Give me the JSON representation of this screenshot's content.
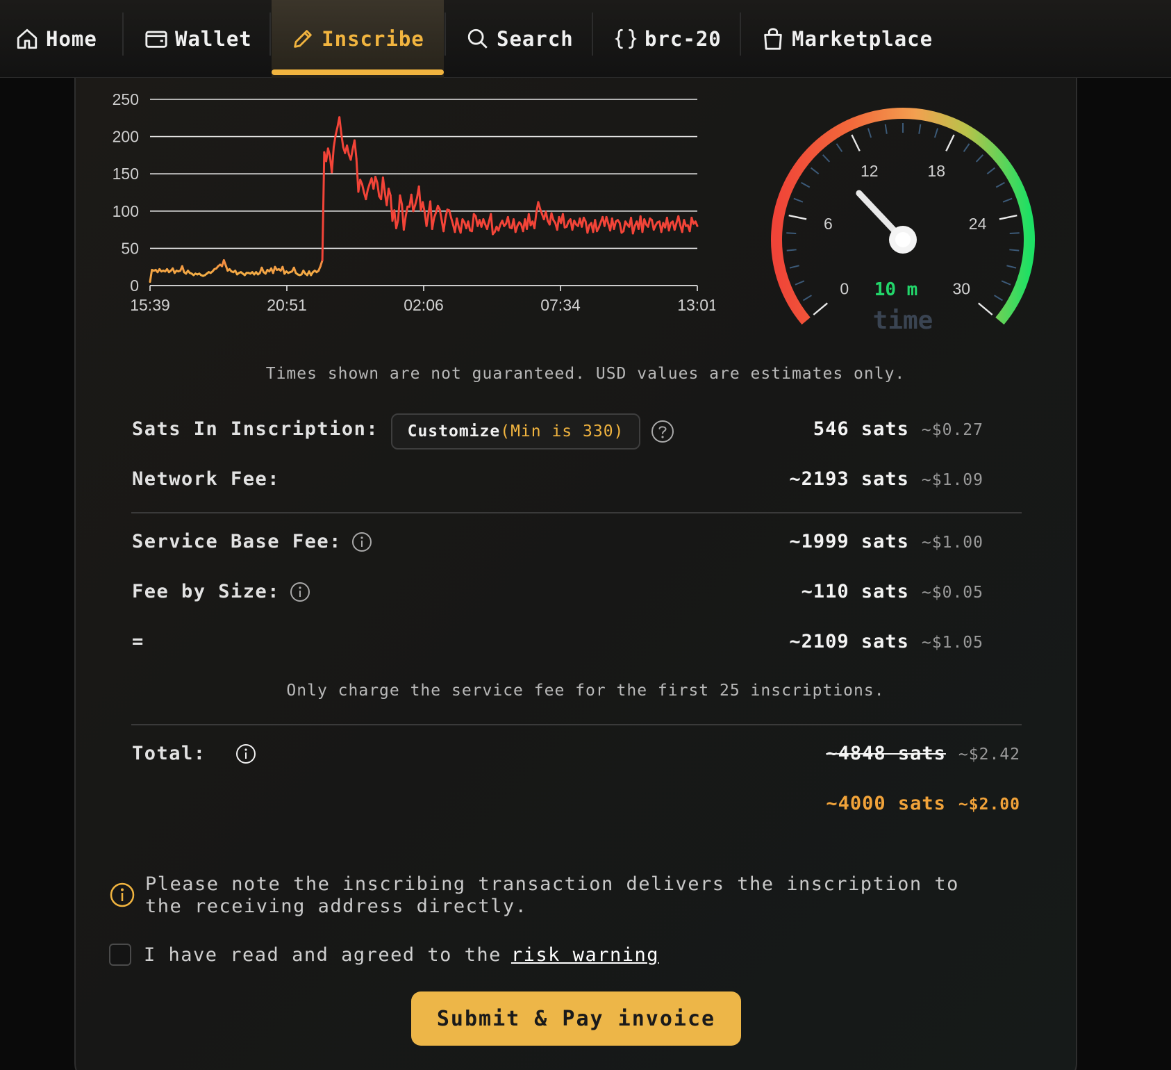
{
  "nav": {
    "items": [
      {
        "label": "Home",
        "icon": "home-icon"
      },
      {
        "label": "Wallet",
        "icon": "wallet-icon"
      },
      {
        "label": "Inscribe",
        "icon": "pencil-icon",
        "active": true
      },
      {
        "label": "Search",
        "icon": "search-icon"
      },
      {
        "label": "brc-20",
        "icon": "braces-icon"
      },
      {
        "label": "Marketplace",
        "icon": "shopping-bag-icon"
      }
    ]
  },
  "chart_data": {
    "type": "line",
    "x_ticks": [
      "15:39",
      "20:51",
      "02:06",
      "07:34",
      "13:01"
    ],
    "y_ticks": [
      "0",
      "50",
      "100",
      "150",
      "200",
      "250"
    ],
    "ylim": [
      0,
      250
    ],
    "grid": true,
    "series": [
      {
        "values": [
          5,
          21,
          20,
          21,
          18,
          22,
          19,
          20,
          19,
          22,
          18,
          20,
          23,
          17,
          20,
          19,
          20,
          26,
          18,
          16,
          20,
          17,
          16,
          14,
          16,
          15,
          16,
          14,
          13,
          14,
          16,
          18,
          17,
          19,
          22,
          23,
          26,
          28,
          26,
          34,
          27,
          20,
          22,
          19,
          18,
          20,
          15,
          17,
          18,
          16,
          14,
          17,
          17,
          16,
          18,
          15,
          18,
          15,
          17,
          24,
          18,
          16,
          21,
          19,
          23,
          17,
          25,
          21,
          22,
          20,
          25,
          16,
          19,
          17,
          18,
          19,
          24,
          17,
          15,
          14,
          15,
          20,
          16,
          14,
          19,
          14,
          18,
          20,
          18,
          20,
          26,
          34,
          179,
          167,
          184,
          174,
          152,
          186,
          202,
          213,
          226,
          204,
          186,
          178,
          188,
          176,
          169,
          183,
          195,
          170,
          126,
          142,
          136,
          125,
          116,
          129,
          137,
          144,
          130,
          146,
          138,
          120,
          116,
          145,
          125,
          108,
          130,
          121,
          87,
          101,
          77,
          88,
          121,
          109,
          75,
          93,
          106,
          106,
          122,
          100,
          108,
          118,
          133,
          101,
          112,
          99,
          80,
          96,
          113,
          76,
          91,
          98,
          107,
          102,
          88,
          73,
          91,
          102,
          101,
          91,
          82,
          72,
          90,
          79,
          71,
          89,
          85,
          77,
          86,
          74,
          73,
          96,
          93,
          80,
          88,
          79,
          89,
          82,
          76,
          86,
          96,
          69,
          72,
          79,
          74,
          82,
          87,
          80,
          83,
          92,
          78,
          77,
          89,
          72,
          80,
          85,
          82,
          73,
          89,
          76,
          96,
          81,
          86,
          77,
          98,
          112,
          103,
          96,
          89,
          99,
          87,
          82,
          97,
          88,
          84,
          75,
          92,
          84,
          96,
          78,
          79,
          86,
          89,
          75,
          87,
          82,
          80,
          90,
          79,
          91,
          86,
          71,
          81,
          84,
          72,
          88,
          73,
          78,
          85,
          92,
          80,
          92,
          83,
          74,
          90,
          76,
          86,
          88,
          84,
          71,
          73,
          86,
          82,
          79,
          91,
          70,
          80,
          86,
          76,
          93,
          72,
          89,
          82,
          79,
          90,
          88,
          75,
          81,
          85,
          86,
          72,
          84,
          78,
          91,
          74,
          84,
          86,
          75,
          84,
          93,
          81,
          72,
          88,
          80,
          81,
          73,
          91,
          83,
          86,
          80
        ]
      }
    ]
  },
  "gauge": {
    "ticks": [
      "0",
      "6",
      "12",
      "18",
      "24",
      "30"
    ],
    "value": 10,
    "max": 30,
    "value_label": "10 m",
    "caption": "time"
  },
  "disclaimer": "Times shown are not guaranteed. USD values are estimates only.",
  "fees": {
    "sats_in_inscription": {
      "label": "Sats In Inscription:",
      "customize": "Customize",
      "customize_min": "(Min is 330)",
      "value": "546 sats",
      "usd": "~$0.27"
    },
    "network_fee": {
      "label": "Network Fee:",
      "value": "~2193 sats",
      "usd": "~$1.09"
    },
    "service_base_fee": {
      "label": "Service Base Fee:",
      "value": "~1999 sats",
      "usd": "~$1.00"
    },
    "fee_by_size": {
      "label": "Fee by Size:",
      "value": "~110 sats",
      "usd": "~$0.05"
    },
    "sum": {
      "label": "=",
      "value": "~2109 sats",
      "usd": "~$1.05"
    },
    "service_note": "Only charge the service fee for the first 25 inscriptions.",
    "total": {
      "label": "Total:",
      "original_value": "~4848 sats",
      "original_usd": "~$2.42",
      "value": "~4000 sats",
      "usd": "~$2.00"
    }
  },
  "warning": "Please note the inscribing transaction delivers the inscription to the receiving address directly.",
  "agreement": {
    "text": "I have read and agreed to the",
    "link": "risk warning"
  },
  "submit_label": "Submit & Pay invoice",
  "colors": {
    "accent": "#f1b43f",
    "gauge_value": "#22d66a"
  }
}
